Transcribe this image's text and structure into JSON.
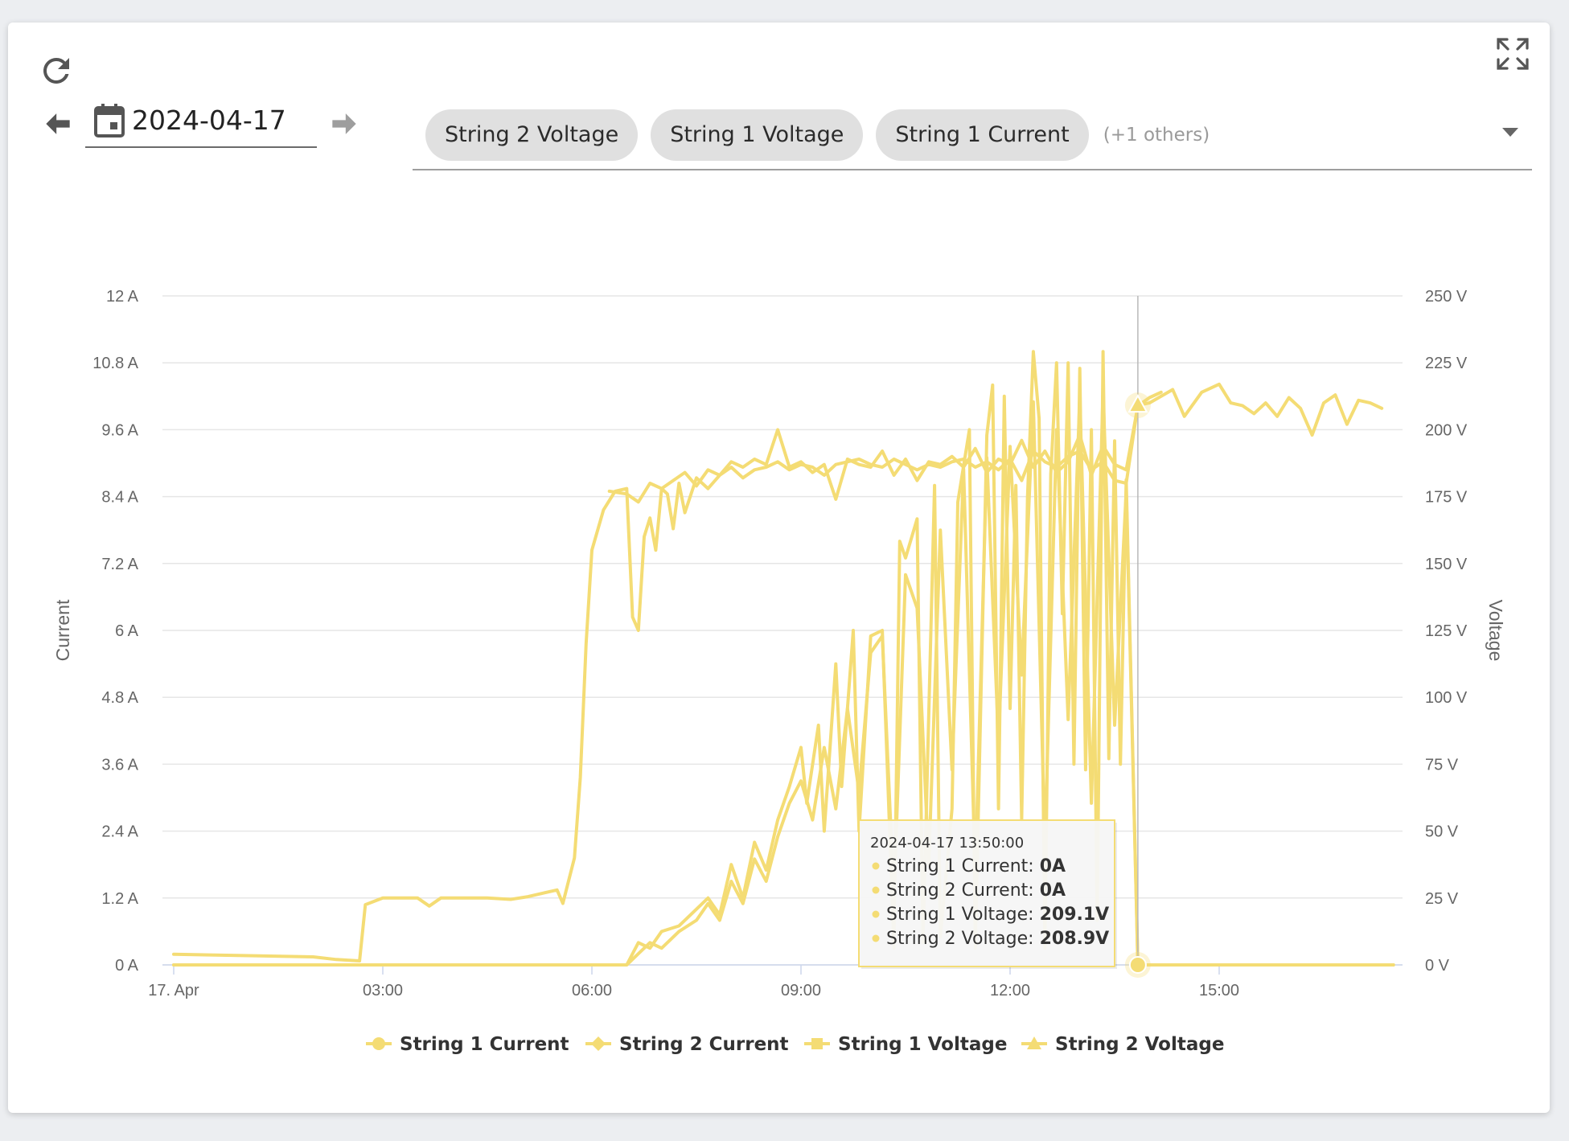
{
  "toolbar": {
    "date_value": "2024-04-17",
    "selected_series_chips": [
      "String 2 Voltage",
      "String 1 Voltage",
      "String 1 Current"
    ],
    "others_label": "(+1 others)"
  },
  "icons": {
    "refresh": "refresh-icon",
    "expand": "fullscreen-icon",
    "prev": "arrow-left-icon",
    "next": "arrow-right-icon",
    "calendar": "calendar-icon",
    "dropdown": "chevron-down-icon"
  },
  "colors": {
    "series": "#f4dc74",
    "gridline": "#e6e6e6",
    "card": "#ffffff",
    "chip": "#e0e0e0"
  },
  "chart_data": {
    "type": "line",
    "title": "",
    "x_type": "datetime",
    "x_range": [
      "2024-04-17 00:00",
      "2024-04-17 17:30"
    ],
    "x_ticks": [
      "17. Apr",
      "03:00",
      "06:00",
      "09:00",
      "12:00",
      "15:00"
    ],
    "y_left": {
      "label": "Current",
      "unit": "A",
      "range": [
        0,
        12
      ],
      "ticks": [
        "0 A",
        "1.2 A",
        "2.4 A",
        "3.6 A",
        "4.8 A",
        "6 A",
        "7.2 A",
        "8.4 A",
        "9.6 A",
        "10.8 A",
        "12 A"
      ]
    },
    "y_right": {
      "label": "Voltage",
      "unit": "V",
      "range": [
        0,
        250
      ],
      "ticks": [
        "0 V",
        "25 V",
        "50 V",
        "75 V",
        "100 V",
        "125 V",
        "150 V",
        "175 V",
        "200 V",
        "225 V",
        "250 V"
      ]
    },
    "grid": true,
    "legend_position": "bottom-center",
    "series": [
      {
        "name": "String 1 Current",
        "axis": "left",
        "marker": "circle",
        "color": "#f4dc74",
        "points": [
          [
            "00:00",
            0
          ],
          [
            "06:30",
            0
          ],
          [
            "06:40",
            0.4
          ],
          [
            "06:50",
            0.3
          ],
          [
            "07:00",
            0.6
          ],
          [
            "07:15",
            0.7
          ],
          [
            "07:30",
            1.0
          ],
          [
            "07:40",
            1.2
          ],
          [
            "07:50",
            0.9
          ],
          [
            "08:00",
            1.8
          ],
          [
            "08:10",
            1.2
          ],
          [
            "08:20",
            2.2
          ],
          [
            "08:30",
            1.7
          ],
          [
            "08:40",
            2.6
          ],
          [
            "08:50",
            3.2
          ],
          [
            "09:00",
            3.9
          ],
          [
            "09:05",
            2.9
          ],
          [
            "09:15",
            4.3
          ],
          [
            "09:20",
            2.4
          ],
          [
            "09:30",
            5.4
          ],
          [
            "09:35",
            3.2
          ],
          [
            "09:45",
            6.0
          ],
          [
            "09:50",
            2.4
          ],
          [
            "10:00",
            5.9
          ],
          [
            "10:10",
            6.0
          ],
          [
            "10:20",
            0.3
          ],
          [
            "10:25",
            7.6
          ],
          [
            "10:30",
            7.3
          ],
          [
            "10:40",
            8.0
          ],
          [
            "10:45",
            0.4
          ],
          [
            "10:55",
            8.6
          ],
          [
            "11:00",
            0.5
          ],
          [
            "11:10",
            2.8
          ],
          [
            "11:15",
            8.3
          ],
          [
            "11:25",
            9.6
          ],
          [
            "11:30",
            0.3
          ],
          [
            "11:40",
            9.5
          ],
          [
            "11:45",
            10.4
          ],
          [
            "11:50",
            2.8
          ],
          [
            "11:55",
            10.2
          ],
          [
            "12:00",
            4.6
          ],
          [
            "12:05",
            8.6
          ],
          [
            "12:10",
            2.6
          ],
          [
            "12:15",
            8.4
          ],
          [
            "12:20",
            11.0
          ],
          [
            "12:25",
            9.8
          ],
          [
            "12:30",
            0.3
          ],
          [
            "12:35",
            8.8
          ],
          [
            "12:40",
            10.8
          ],
          [
            "12:45",
            6.3
          ],
          [
            "12:50",
            10.8
          ],
          [
            "12:55",
            3.6
          ],
          [
            "13:00",
            10.7
          ],
          [
            "13:05",
            3.5
          ],
          [
            "13:10",
            9.6
          ],
          [
            "13:15",
            0.8
          ],
          [
            "13:20",
            11.0
          ],
          [
            "13:25",
            3.7
          ],
          [
            "13:30",
            9.4
          ],
          [
            "13:35",
            3.6
          ],
          [
            "13:40",
            8.7
          ],
          [
            "13:50",
            0
          ],
          [
            "14:10",
            0
          ],
          [
            "17:30",
            0
          ]
        ]
      },
      {
        "name": "String 2 Current",
        "axis": "left",
        "marker": "diamond",
        "color": "#f4dc74",
        "points": [
          [
            "00:00",
            0
          ],
          [
            "06:30",
            0
          ],
          [
            "06:40",
            0.2
          ],
          [
            "06:50",
            0.4
          ],
          [
            "07:00",
            0.3
          ],
          [
            "07:15",
            0.6
          ],
          [
            "07:30",
            0.8
          ],
          [
            "07:40",
            1.1
          ],
          [
            "07:50",
            0.8
          ],
          [
            "08:00",
            1.5
          ],
          [
            "08:10",
            1.1
          ],
          [
            "08:20",
            1.9
          ],
          [
            "08:30",
            1.5
          ],
          [
            "08:40",
            2.3
          ],
          [
            "08:50",
            2.9
          ],
          [
            "09:00",
            3.3
          ],
          [
            "09:10",
            2.6
          ],
          [
            "09:20",
            3.9
          ],
          [
            "09:30",
            2.8
          ],
          [
            "09:40",
            4.6
          ],
          [
            "09:50",
            3.1
          ],
          [
            "10:00",
            5.6
          ],
          [
            "10:10",
            5.9
          ],
          [
            "10:20",
            1.2
          ],
          [
            "10:30",
            7.0
          ],
          [
            "10:40",
            6.4
          ],
          [
            "10:50",
            1.8
          ],
          [
            "11:00",
            7.8
          ],
          [
            "11:10",
            3.5
          ],
          [
            "11:20",
            8.9
          ],
          [
            "11:30",
            1.6
          ],
          [
            "11:40",
            9.1
          ],
          [
            "11:50",
            4.0
          ],
          [
            "12:00",
            9.3
          ],
          [
            "12:10",
            5.2
          ],
          [
            "12:20",
            10.1
          ],
          [
            "12:30",
            2.1
          ],
          [
            "12:40",
            9.6
          ],
          [
            "12:50",
            4.4
          ],
          [
            "13:00",
            10.2
          ],
          [
            "13:10",
            2.9
          ],
          [
            "13:20",
            10.3
          ],
          [
            "13:30",
            4.3
          ],
          [
            "13:40",
            8.5
          ],
          [
            "13:50",
            0
          ],
          [
            "17:30",
            0
          ]
        ]
      },
      {
        "name": "String 1 Voltage",
        "axis": "right",
        "marker": "square",
        "color": "#f4dc74",
        "points": [
          [
            "00:00",
            4.0
          ],
          [
            "01:00",
            3.5
          ],
          [
            "02:00",
            3.0
          ],
          [
            "02:20",
            2.0
          ],
          [
            "02:40",
            1.5
          ],
          [
            "02:45",
            22.5
          ],
          [
            "03:00",
            25.0
          ],
          [
            "03:30",
            25.0
          ],
          [
            "03:40",
            22.0
          ],
          [
            "03:50",
            25.0
          ],
          [
            "04:30",
            25.0
          ],
          [
            "04:50",
            24.5
          ],
          [
            "05:05",
            25.5
          ],
          [
            "05:20",
            27.0
          ],
          [
            "05:30",
            28.0
          ],
          [
            "05:35",
            23.0
          ],
          [
            "05:45",
            40.0
          ],
          [
            "05:50",
            70.0
          ],
          [
            "05:55",
            120.0
          ],
          [
            "06:00",
            155.0
          ],
          [
            "06:10",
            170.0
          ],
          [
            "06:20",
            177.0
          ],
          [
            "06:30",
            178.0
          ],
          [
            "06:35",
            130.0
          ],
          [
            "06:40",
            125.0
          ],
          [
            "06:45",
            160.0
          ],
          [
            "06:50",
            167.0
          ],
          [
            "06:55",
            155.0
          ],
          [
            "07:00",
            178.0
          ],
          [
            "07:05",
            176.0
          ],
          [
            "07:10",
            163.0
          ],
          [
            "07:15",
            180.0
          ],
          [
            "07:20",
            169.0
          ],
          [
            "07:30",
            182.0
          ],
          [
            "07:40",
            178.0
          ],
          [
            "07:50",
            183.0
          ],
          [
            "08:00",
            186.0
          ],
          [
            "08:10",
            182.0
          ],
          [
            "08:20",
            185.0
          ],
          [
            "08:30",
            186.0
          ],
          [
            "08:40",
            188.0
          ],
          [
            "08:50",
            185.0
          ],
          [
            "09:00",
            187.0
          ],
          [
            "09:10",
            186.0
          ],
          [
            "09:20",
            183.0
          ],
          [
            "09:30",
            187.0
          ],
          [
            "09:40",
            188.0
          ],
          [
            "09:50",
            189.0
          ],
          [
            "10:00",
            187.0
          ],
          [
            "10:10",
            186.0
          ],
          [
            "10:20",
            189.0
          ],
          [
            "10:30",
            187.0
          ],
          [
            "10:40",
            185.0
          ],
          [
            "10:50",
            187.0
          ],
          [
            "11:00",
            186.0
          ],
          [
            "11:10",
            188.0
          ],
          [
            "11:20",
            189.0
          ],
          [
            "11:30",
            186.0
          ],
          [
            "11:40",
            188.0
          ],
          [
            "11:50",
            185.0
          ],
          [
            "12:00",
            189.0
          ],
          [
            "12:10",
            181.0
          ],
          [
            "12:20",
            192.0
          ],
          [
            "12:30",
            188.0
          ],
          [
            "12:40",
            186.0
          ],
          [
            "12:50",
            190.0
          ],
          [
            "13:00",
            192.0
          ],
          [
            "13:10",
            185.0
          ],
          [
            "13:20",
            188.0
          ],
          [
            "13:30",
            181.0
          ],
          [
            "13:40",
            180.0
          ],
          [
            "13:50",
            209.1
          ],
          [
            "14:00",
            210.0
          ],
          [
            "14:20",
            215.0
          ],
          [
            "14:30",
            205.0
          ],
          [
            "14:45",
            214.0
          ],
          [
            "15:00",
            217.0
          ],
          [
            "15:10",
            210.0
          ],
          [
            "15:20",
            209.0
          ],
          [
            "15:30",
            206.0
          ],
          [
            "15:40",
            210.0
          ],
          [
            "15:50",
            205.0
          ],
          [
            "16:00",
            212.0
          ],
          [
            "16:10",
            208.0
          ],
          [
            "16:20",
            198.0
          ],
          [
            "16:30",
            210.0
          ],
          [
            "16:40",
            213.0
          ],
          [
            "16:50",
            202.0
          ],
          [
            "17:00",
            211.0
          ],
          [
            "17:10",
            210.0
          ],
          [
            "17:20",
            208.0
          ]
        ]
      },
      {
        "name": "String 2 Voltage",
        "axis": "right",
        "marker": "triangle",
        "color": "#f4dc74",
        "points": [
          [
            "06:15",
            177.0
          ],
          [
            "06:30",
            176.0
          ],
          [
            "06:40",
            173.0
          ],
          [
            "06:50",
            180.0
          ],
          [
            "07:00",
            178.0
          ],
          [
            "07:10",
            181.0
          ],
          [
            "07:20",
            184.0
          ],
          [
            "07:30",
            179.0
          ],
          [
            "07:40",
            185.0
          ],
          [
            "07:50",
            183.0
          ],
          [
            "08:00",
            188.0
          ],
          [
            "08:10",
            186.0
          ],
          [
            "08:20",
            189.0
          ],
          [
            "08:30",
            187.0
          ],
          [
            "08:40",
            200.0
          ],
          [
            "08:50",
            186.0
          ],
          [
            "09:00",
            188.0
          ],
          [
            "09:10",
            184.0
          ],
          [
            "09:20",
            187.0
          ],
          [
            "09:30",
            174.0
          ],
          [
            "09:40",
            189.0
          ],
          [
            "09:50",
            187.0
          ],
          [
            "10:00",
            186.0
          ],
          [
            "10:10",
            192.0
          ],
          [
            "10:20",
            183.0
          ],
          [
            "10:30",
            189.0
          ],
          [
            "10:40",
            181.0
          ],
          [
            "10:50",
            188.0
          ],
          [
            "11:00",
            187.0
          ],
          [
            "11:10",
            190.0
          ],
          [
            "11:20",
            186.0
          ],
          [
            "11:30",
            193.0
          ],
          [
            "11:40",
            184.0
          ],
          [
            "11:50",
            189.0
          ],
          [
            "12:00",
            187.0
          ],
          [
            "12:10",
            196.0
          ],
          [
            "12:20",
            186.0
          ],
          [
            "12:30",
            192.0
          ],
          [
            "12:40",
            184.0
          ],
          [
            "12:50",
            188.0
          ],
          [
            "13:00",
            198.0
          ],
          [
            "13:10",
            183.0
          ],
          [
            "13:20",
            194.0
          ],
          [
            "13:30",
            187.0
          ],
          [
            "13:40",
            185.0
          ],
          [
            "13:50",
            208.9
          ],
          [
            "14:00",
            212.0
          ],
          [
            "14:10",
            214.0
          ]
        ]
      }
    ],
    "tooltip": {
      "header": "2024-04-17 13:50:00",
      "rows": [
        {
          "label": "String 1 Current: ",
          "value": "0A"
        },
        {
          "label": "String 2 Current: ",
          "value": "0A"
        },
        {
          "label": "String 1 Voltage: ",
          "value": "209.1V"
        },
        {
          "label": "String 2 Voltage: ",
          "value": "208.9V"
        }
      ],
      "crosshair_time": "13:50"
    }
  }
}
